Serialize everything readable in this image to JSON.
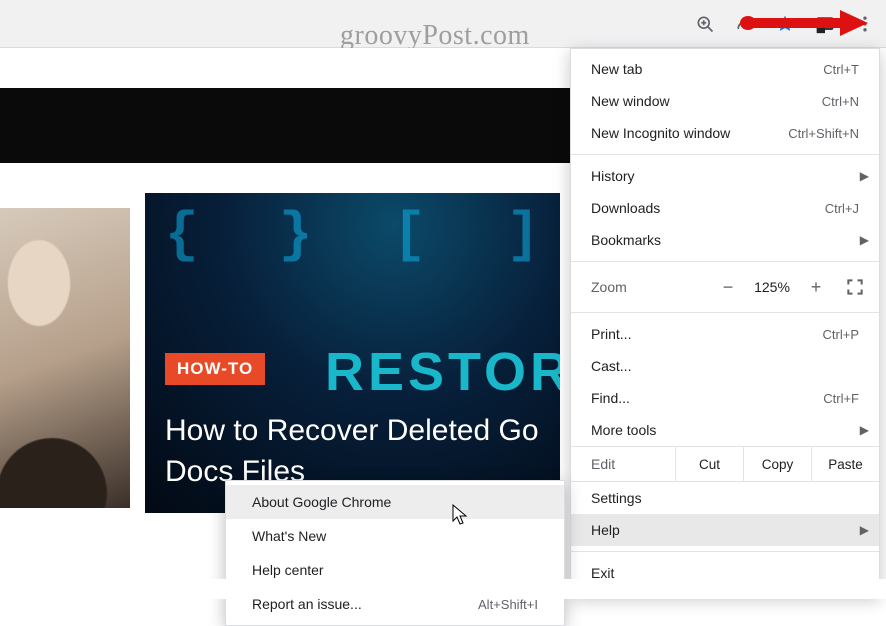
{
  "watermark": "groovyPost.com",
  "toolbar_icons": {
    "zoom": "zoom-icon",
    "share": "share-icon",
    "bookmark": "bookmark-star-icon",
    "cast": "cast-icon",
    "kebab": "more-vert-icon"
  },
  "article": {
    "badge": "HOW-TO",
    "restore_fragment": "RESTOR",
    "title": "How to Recover Deleted Go Docs Files"
  },
  "menu": {
    "new_tab": {
      "label": "New tab",
      "accel": "Ctrl+T"
    },
    "new_window": {
      "label": "New window",
      "accel": "Ctrl+N"
    },
    "new_incognito": {
      "label": "New Incognito window",
      "accel": "Ctrl+Shift+N"
    },
    "history": {
      "label": "History"
    },
    "downloads": {
      "label": "Downloads",
      "accel": "Ctrl+J"
    },
    "bookmarks": {
      "label": "Bookmarks"
    },
    "zoom": {
      "label": "Zoom",
      "minus": "−",
      "value": "125%",
      "plus": "+"
    },
    "print": {
      "label": "Print...",
      "accel": "Ctrl+P"
    },
    "cast": {
      "label": "Cast..."
    },
    "find": {
      "label": "Find...",
      "accel": "Ctrl+F"
    },
    "more_tools": {
      "label": "More tools"
    },
    "edit": {
      "label": "Edit",
      "cut": "Cut",
      "copy": "Copy",
      "paste": "Paste"
    },
    "settings": {
      "label": "Settings"
    },
    "help": {
      "label": "Help"
    },
    "exit": {
      "label": "Exit"
    }
  },
  "help_submenu": {
    "about": {
      "label": "About Google Chrome"
    },
    "whats_new": {
      "label": "What's New"
    },
    "help_center": {
      "label": "Help center"
    },
    "report": {
      "label": "Report an issue...",
      "accel": "Alt+Shift+I"
    }
  }
}
